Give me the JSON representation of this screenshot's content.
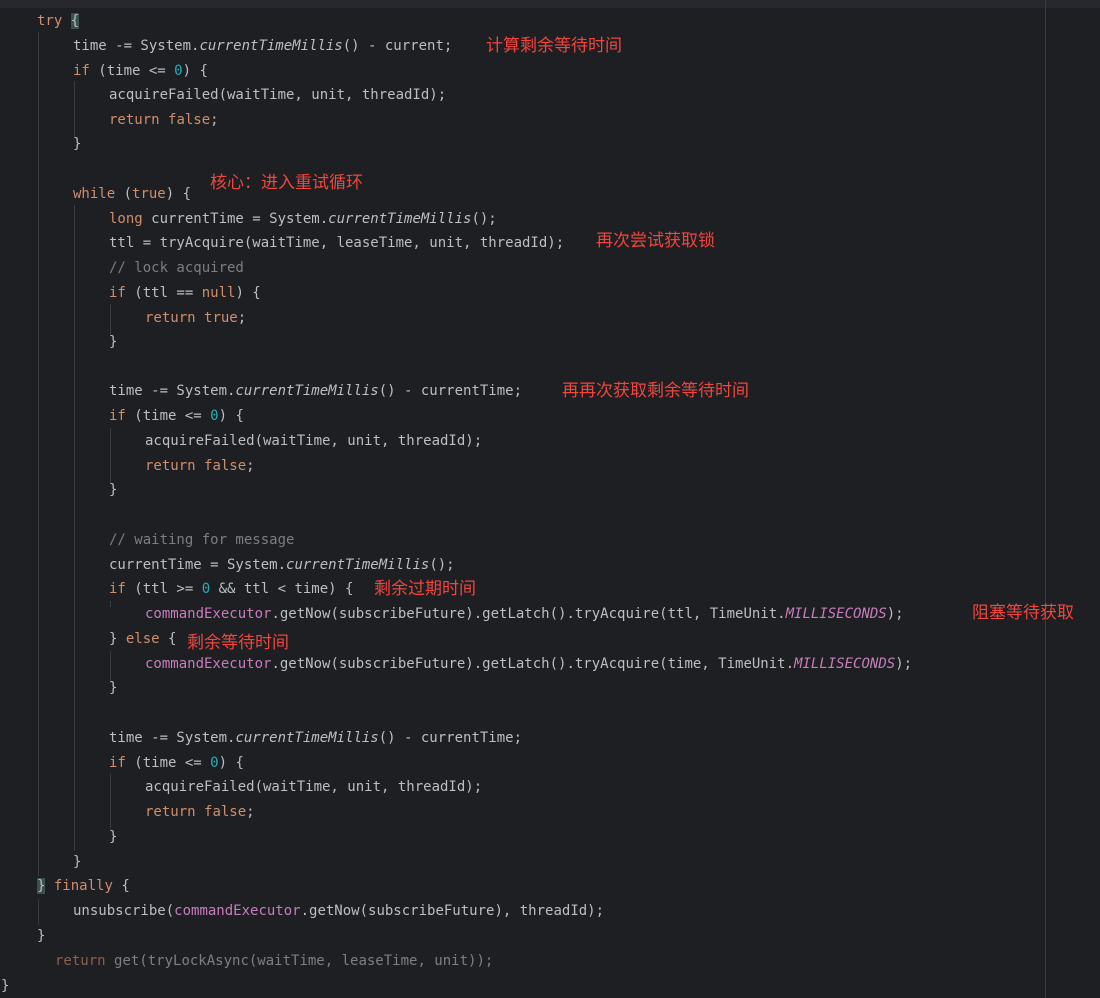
{
  "code": {
    "try_kw": "try",
    "open_brace": "{",
    "close_brace": "}",
    "finally_kw": "finally",
    "while_kw": "while",
    "true_kw": "true",
    "false_kw": "false",
    "null_kw": "null",
    "if_kw": "if",
    "return_kw": "return",
    "long_kw": "long",
    "else_kw": "else",
    "zero": "0",
    "l_time_a": "time -= System.",
    "time_millis": "currentTimeMillis",
    "l_time_b": "() - current;",
    "l_if_time": "(time <= ",
    "l_if_tail": ") {",
    "acquire_failed": "acquireFailed(waitTime, unit, threadId);",
    "while_cond_open": " (",
    "while_cond_close": ") {",
    "long_decl_a": " currentTime = System.",
    "call_end": "();",
    "ttl_assign": "ttl = tryAcquire(waitTime, leaseTime, unit, threadId);",
    "comment_lock": "// lock acquired",
    "if_ttl_a": " (ttl == ",
    "time_sub_ct_b": "() - currentTime;",
    "comment_wait": "// waiting for message",
    "ct_assign_a": "currentTime = System.",
    "if_ttl_range_a": " (ttl >= ",
    "if_ttl_range_b": " && ttl < time) {",
    "cmd_executor": "commandExecutor",
    "get_now_ttl": ".getNow(subscribeFuture).getLatch().tryAcquire(ttl, TimeUnit.",
    "get_now_time": ".getNow(subscribeFuture).getLatch().tryAcquire(time, TimeUnit.",
    "milliseconds": "MILLISECONDS",
    "call_close": ");",
    "unsub_a": "unsubscribe(",
    "unsub_b": ".getNow(subscribeFuture), threadId);",
    "return_get": "get(tryLockAsync(waitTime, leaseTime, unit));"
  },
  "annotations": {
    "calc_remaining": "计算剩余等待时间",
    "core_loop": "核心：进入重试循环",
    "retry_acquire": "再次尝试获取锁",
    "recalc_remaining": "再再次获取剩余等待时间",
    "remaining_expire": "剩余过期时间",
    "block_wait": "阻塞等待获取",
    "remaining_wait": "剩余等待时间"
  },
  "colors": {
    "background": "#1e1f22",
    "keyword": "#cf8e6d",
    "number": "#2aacb8",
    "field": "#c77dbb",
    "comment": "#7a7e85",
    "annotation": "#f0463e"
  }
}
